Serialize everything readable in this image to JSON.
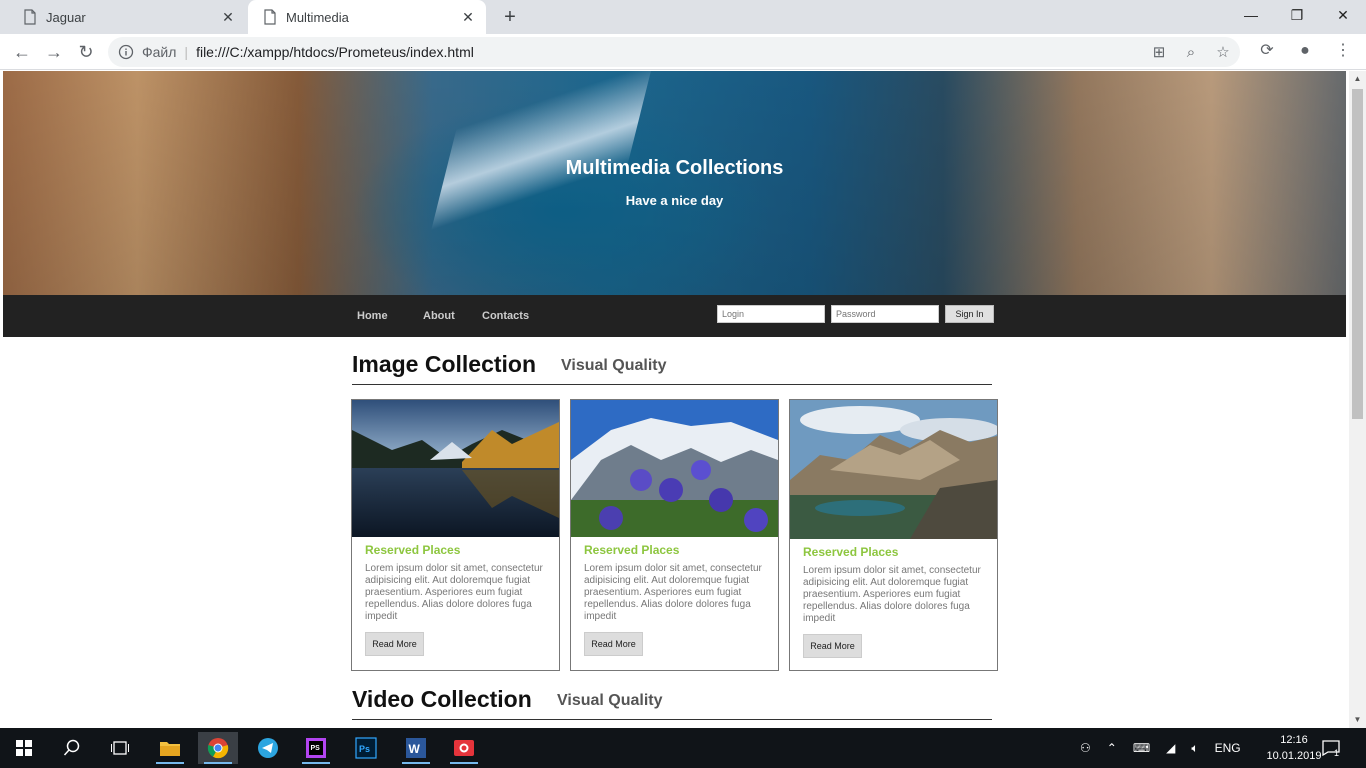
{
  "browser": {
    "tabs": [
      {
        "title": "Jaguar"
      },
      {
        "title": "Multimedia"
      }
    ],
    "scheme_label": "Файл",
    "url": "file:///C:/xampp/htdocs/Prometeus/index.html"
  },
  "hero": {
    "title": "Multimedia Collections",
    "subtitle": "Have a nice day"
  },
  "nav": {
    "links": [
      "Home",
      "About",
      "Contacts"
    ],
    "login_placeholder": "Login",
    "password_placeholder": "Password",
    "signin_label": "Sign In"
  },
  "image_section": {
    "title": "Image Collection",
    "subtitle": "Visual Quality"
  },
  "cards": [
    {
      "title": "Reserved Places",
      "text": "Lorem ipsum dolor sit amet, consectetur adipisicing elit. Aut doloremque fugiat praesentium. Asperiores eum fugiat repellendus. Alias dolore dolores fuga impedit",
      "button": "Read More"
    },
    {
      "title": "Reserved Places",
      "text": "Lorem ipsum dolor sit amet, consectetur adipisicing elit. Aut doloremque fugiat praesentium. Asperiores eum fugiat repellendus. Alias dolore dolores fuga impedit",
      "button": "Read More"
    },
    {
      "title": "Reserved Places",
      "text": "Lorem ipsum dolor sit amet, consectetur adipisicing elit. Aut doloremque fugiat praesentium. Asperiores eum fugiat repellendus. Alias dolore dolores fuga impedit",
      "button": "Read More"
    }
  ],
  "video_section": {
    "title": "Video Collection",
    "subtitle": "Visual Quality"
  },
  "taskbar": {
    "language": "ENG",
    "time": "12:16",
    "date": "10.01.2019",
    "notification_count": "1",
    "apps": [
      "start-icon",
      "search-icon",
      "task-view-icon",
      "file-explorer-icon",
      "chrome-icon",
      "telegram-icon",
      "phpstorm-icon",
      "photoshop-icon",
      "word-icon",
      "screenshot-app-icon"
    ]
  },
  "colors": {
    "card_title": "#8dc63f",
    "navbar": "#222222",
    "taskbar": "#101418"
  }
}
